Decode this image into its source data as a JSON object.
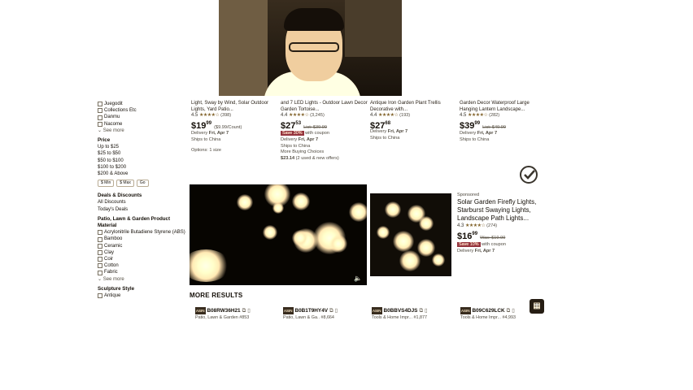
{
  "sidebar": {
    "brand_items": [
      "Juegodit",
      "Collections Etc",
      "Danmu",
      "Nacome"
    ],
    "see_more_1": "See more",
    "price_title": "Price",
    "price_ranges": [
      "Up to $25",
      "$25 to $50",
      "$50 to $100",
      "$100 to $200",
      "$200 & Above"
    ],
    "price_min": "$ Min",
    "price_max": "$ Max",
    "price_go": "Go",
    "deals_title": "Deals & Discounts",
    "deals_items": [
      "All Discounts",
      "Today's Deals"
    ],
    "material_title": "Patio, Lawn & Garden Product Material",
    "material_items": [
      "Acrylonitrile Butadiene Styrene (ABS)",
      "Bamboo",
      "Ceramic",
      "Clay",
      "Coir",
      "Cotton",
      "Fabric"
    ],
    "see_more_2": "See more",
    "sculpture_title": "Sculpture Style",
    "sculpture_items": [
      "Antique"
    ]
  },
  "products": [
    {
      "title": "Light, Sway by Wind, Solar Outdoor Lights, Yard Patio...",
      "rating": "4.5",
      "stars": "★★★★☆",
      "reviews": "(398)",
      "price_whole": "$19",
      "price_frac": "99",
      "unit": "($9.99/Count)",
      "delivery_label": "Delivery",
      "delivery_date": "Fri, Apr 7",
      "ships": "Ships to China",
      "extra": "Options: 1 size"
    },
    {
      "title": "and 7 LED Lights - Outdoor Lawn Decor Garden Tortoise...",
      "rating": "4.4",
      "stars": "★★★★☆",
      "reviews": "(3,245)",
      "price_whole": "$27",
      "price_frac": "53",
      "list_price": "List: $39.99",
      "save": "Save 30%",
      "save_suffix": "with coupon",
      "delivery_label": "Delivery",
      "delivery_date": "Fri, Apr 7",
      "ships": "Ships to China",
      "more_choices": "More Buying Choices",
      "more_price": "$23.14",
      "more_offers": "(2 used & new offers)"
    },
    {
      "title": "Antique Iron Garden Plant Trellis Decorative with...",
      "rating": "4.4",
      "stars": "★★★★☆",
      "reviews": "(193)",
      "price_whole": "$27",
      "price_frac": "68",
      "delivery_label": "Delivery",
      "delivery_date": "Fri, Apr 7",
      "ships": "Ships to China"
    },
    {
      "title": "Garden Decor Waterproof Large Hanging Lantern Landscape...",
      "rating": "4.5",
      "stars": "★★★★☆",
      "reviews": "(282)",
      "price_whole": "$39",
      "price_frac": "99",
      "list_price": "List: $49.99",
      "delivery_label": "Delivery",
      "delivery_date": "Fri, Apr 7",
      "ships": "Ships to China"
    }
  ],
  "sponsored": {
    "label": "Sponsored",
    "title": "Solar Garden Firefly Lights, Starburst Swaying Lights, Landscape Path Lights...",
    "rating": "4.3",
    "stars": "★★★★☆",
    "reviews": "(274)",
    "price_whole": "$16",
    "price_frac": "99",
    "list_price": "Was: $19.99",
    "save": "Save 10%",
    "save_suffix": "with coupon",
    "delivery_label": "Delivery",
    "delivery_date": "Fri, Apr 7"
  },
  "more_results_heading": "MORE RESULTS",
  "asins": [
    {
      "code": "B08RW36H21",
      "rank": "Patio, Lawn & Garden #853"
    },
    {
      "code": "B0B1T9HY4V",
      "rank": "Patio, Lawn & Ga.. #8,664"
    },
    {
      "code": "B0BBVS4DJS",
      "rank": "Tools & Home Impr... #1,877"
    },
    {
      "code": "B09C629LCK",
      "rank": "Tools & Home Impr... #4,993"
    }
  ],
  "asin_chip": "ASIN",
  "grid_icon": "grid-icon"
}
